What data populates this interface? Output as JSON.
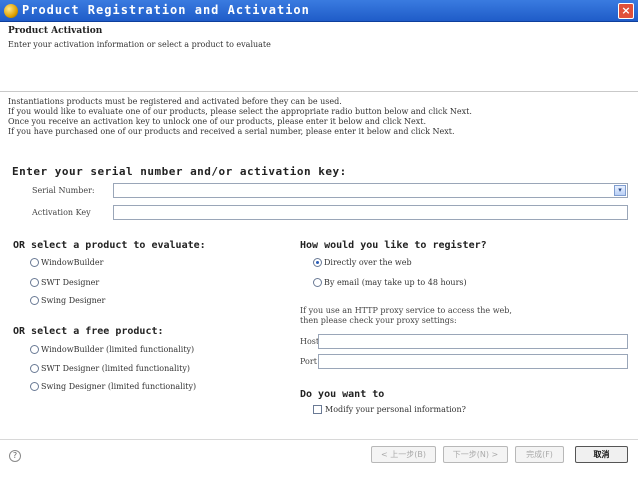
{
  "window": {
    "title": "Product Registration and Activation",
    "close_glyph": "×",
    "app_icon": "eclipse-icon"
  },
  "header": {
    "title": "Product Activation",
    "description": "Enter your activation information or select a product to evaluate"
  },
  "info_lines": [
    "Instantiations products must be registered and activated before they can be used.",
    "If you would like to evaluate one of our products, please select the appropriate radio button below and click Next.",
    "Once you receive an activation key to unlock one of our products, please enter it below and click Next.",
    "If you have purchased one of our products and received a serial number, please enter it below and click Next."
  ],
  "serial": {
    "heading": "Enter your serial number and/or activation key:",
    "serial_label": "Serial Number:",
    "serial_value": "",
    "serial_dropdown_glyph": "▾",
    "activation_label": "Activation Key",
    "activation_value": ""
  },
  "evaluate": {
    "heading": "OR select a product to evaluate:",
    "options": [
      "WindowBuilder",
      "SWT Designer",
      "Swing Designer"
    ]
  },
  "free": {
    "heading": "OR select a free product:",
    "options": [
      "WindowBuilder (limited functionality)",
      "SWT Designer (limited functionality)",
      "Swing Designer (limited functionality)"
    ]
  },
  "register": {
    "heading": "How would you like to register?",
    "options": [
      "Directly over the web",
      "By email (may take up to 48 hours)"
    ],
    "selected": 0,
    "proxy_note_1": "If you use an HTTP proxy service to access the web,",
    "proxy_note_2": "then please check your proxy settings:",
    "host_label": "Host",
    "host_value": "",
    "port_label": "Port",
    "port_value": ""
  },
  "personal": {
    "heading": "Do you want to",
    "checkbox_label": "Modify your personal information?",
    "checked": false
  },
  "footer": {
    "help_glyph": "?",
    "back_label": "< 上一步(B)",
    "next_label": "下一步(N) >",
    "finish_label": "完成(F)",
    "cancel_label": "取消"
  }
}
